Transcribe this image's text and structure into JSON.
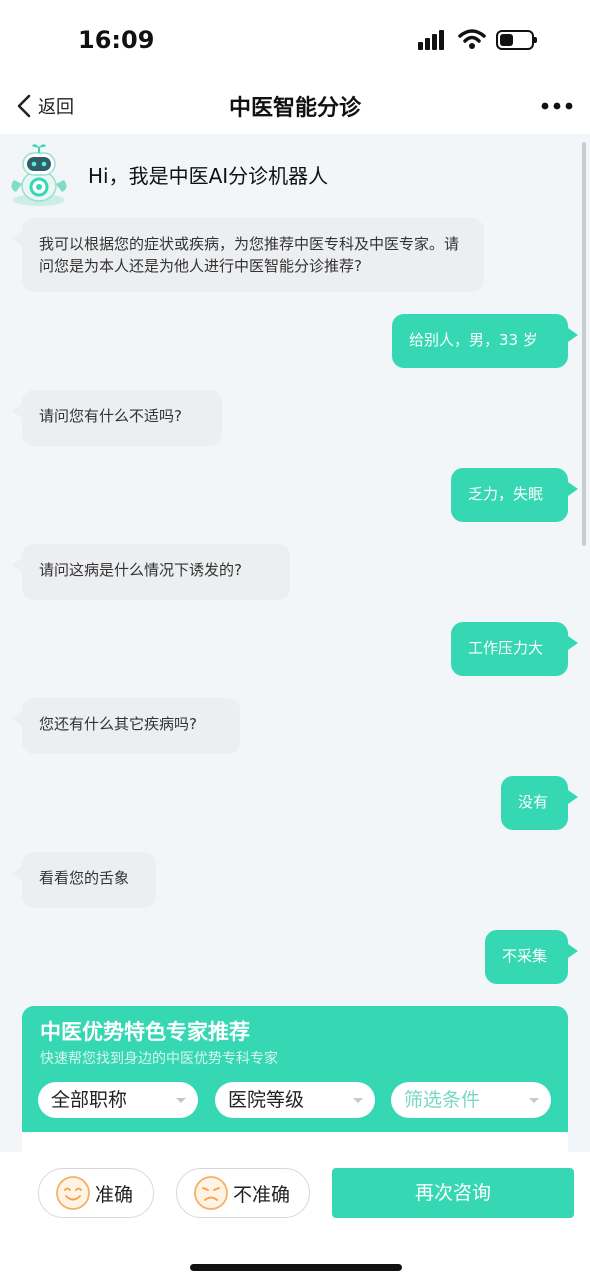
{
  "status": {
    "time": "16:09"
  },
  "nav": {
    "back_label": "返回",
    "title": "中医智能分诊"
  },
  "chat": {
    "greeting": "Hi，我是中医AI分诊机器人",
    "messages": [
      {
        "from": "bot",
        "text": "我可以根据您的症状或疾病，为您推荐中医专科及中医专家。请问您是为本人还是为他人进行中医智能分诊推荐?"
      },
      {
        "from": "user",
        "text": "给别人，男，33 岁"
      },
      {
        "from": "bot",
        "text": "请问您有什么不适吗?"
      },
      {
        "from": "user",
        "text": "乏力，失眠"
      },
      {
        "from": "bot",
        "text": "请问这病是什么情况下诱发的?"
      },
      {
        "from": "user",
        "text": "工作压力大"
      },
      {
        "from": "bot",
        "text": "您还有什么其它疾病吗?"
      },
      {
        "from": "user",
        "text": "没有"
      },
      {
        "from": "bot",
        "text": "看看您的舌象"
      },
      {
        "from": "user",
        "text": "不采集"
      }
    ]
  },
  "card": {
    "title": "中医优势特色专家推荐",
    "subtitle": "快速帮您找到身边的中医优势专科专家",
    "filters": [
      "全部职称",
      "医院等级",
      "筛选条件"
    ]
  },
  "bottom": {
    "accurate_label": "准确",
    "inaccurate_label": "不准确",
    "consult_label": "再次咨询"
  },
  "colors": {
    "accent": "#35d8b3",
    "bot_bubble": "#eceef0",
    "background": "#f3f6f8"
  }
}
